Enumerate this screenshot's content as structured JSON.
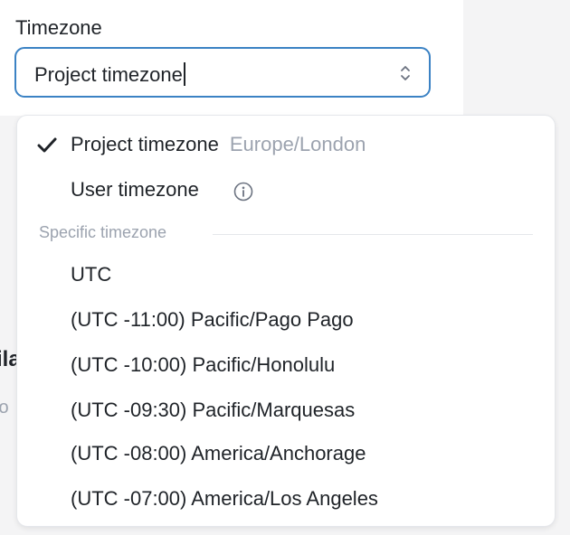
{
  "field": {
    "label": "Timezone",
    "value": "Project timezone"
  },
  "background": {
    "fragment_1": "ila",
    "fragment_2": "io"
  },
  "menu": {
    "project_option": {
      "label": "Project timezone",
      "sublabel": "Europe/London",
      "selected": true
    },
    "user_option": {
      "label": "User timezone"
    },
    "section_title": "Specific timezone",
    "timezones": [
      "UTC",
      "(UTC -11:00) Pacific/Pago Pago",
      "(UTC -10:00) Pacific/Honolulu",
      "(UTC -09:30) Pacific/Marquesas",
      "(UTC -08:00) America/Anchorage",
      "(UTC -07:00) America/Los Angeles"
    ]
  },
  "icons": {
    "check": "checkmark-icon",
    "info": "info-icon",
    "select": "chevron-up-down-icon"
  },
  "colors": {
    "focus_border": "#3b82c4",
    "text": "#1f2328",
    "muted": "#9ca3af"
  }
}
